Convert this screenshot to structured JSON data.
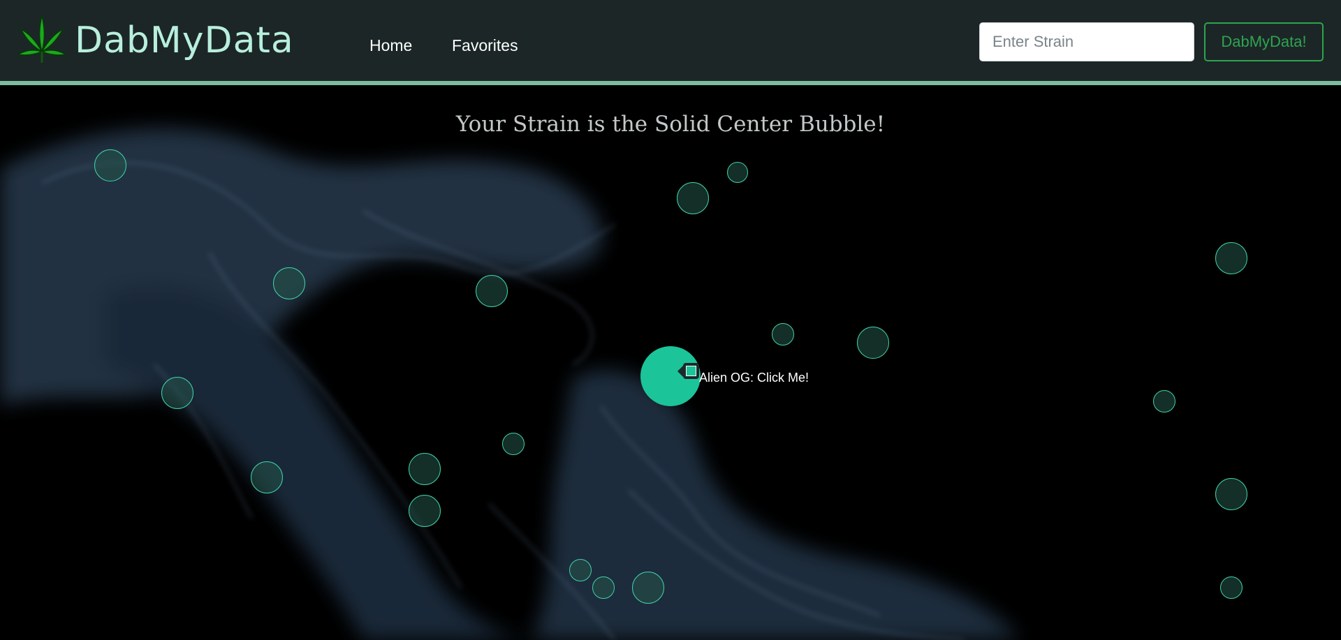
{
  "brand": {
    "name": "DabMyData"
  },
  "nav": {
    "home_label": "Home",
    "favorites_label": "Favorites"
  },
  "search": {
    "placeholder": "Enter Strain",
    "value": "",
    "button_label": "DabMyData!"
  },
  "main": {
    "headline": "Your Strain is the Solid Center Bubble!"
  },
  "center_bubble": {
    "tooltip": "Alien OG: Click Me!"
  },
  "colors": {
    "accent": "#1cc49a",
    "bubble_stroke": "#3fd3a9",
    "navbar_bg": "#1c2627",
    "navbar_border": "#7dbd9f",
    "brand_text": "#b8efdc",
    "button_green": "#2ea44f"
  },
  "icons": {
    "logo": "cannabis-leaf-icon"
  }
}
